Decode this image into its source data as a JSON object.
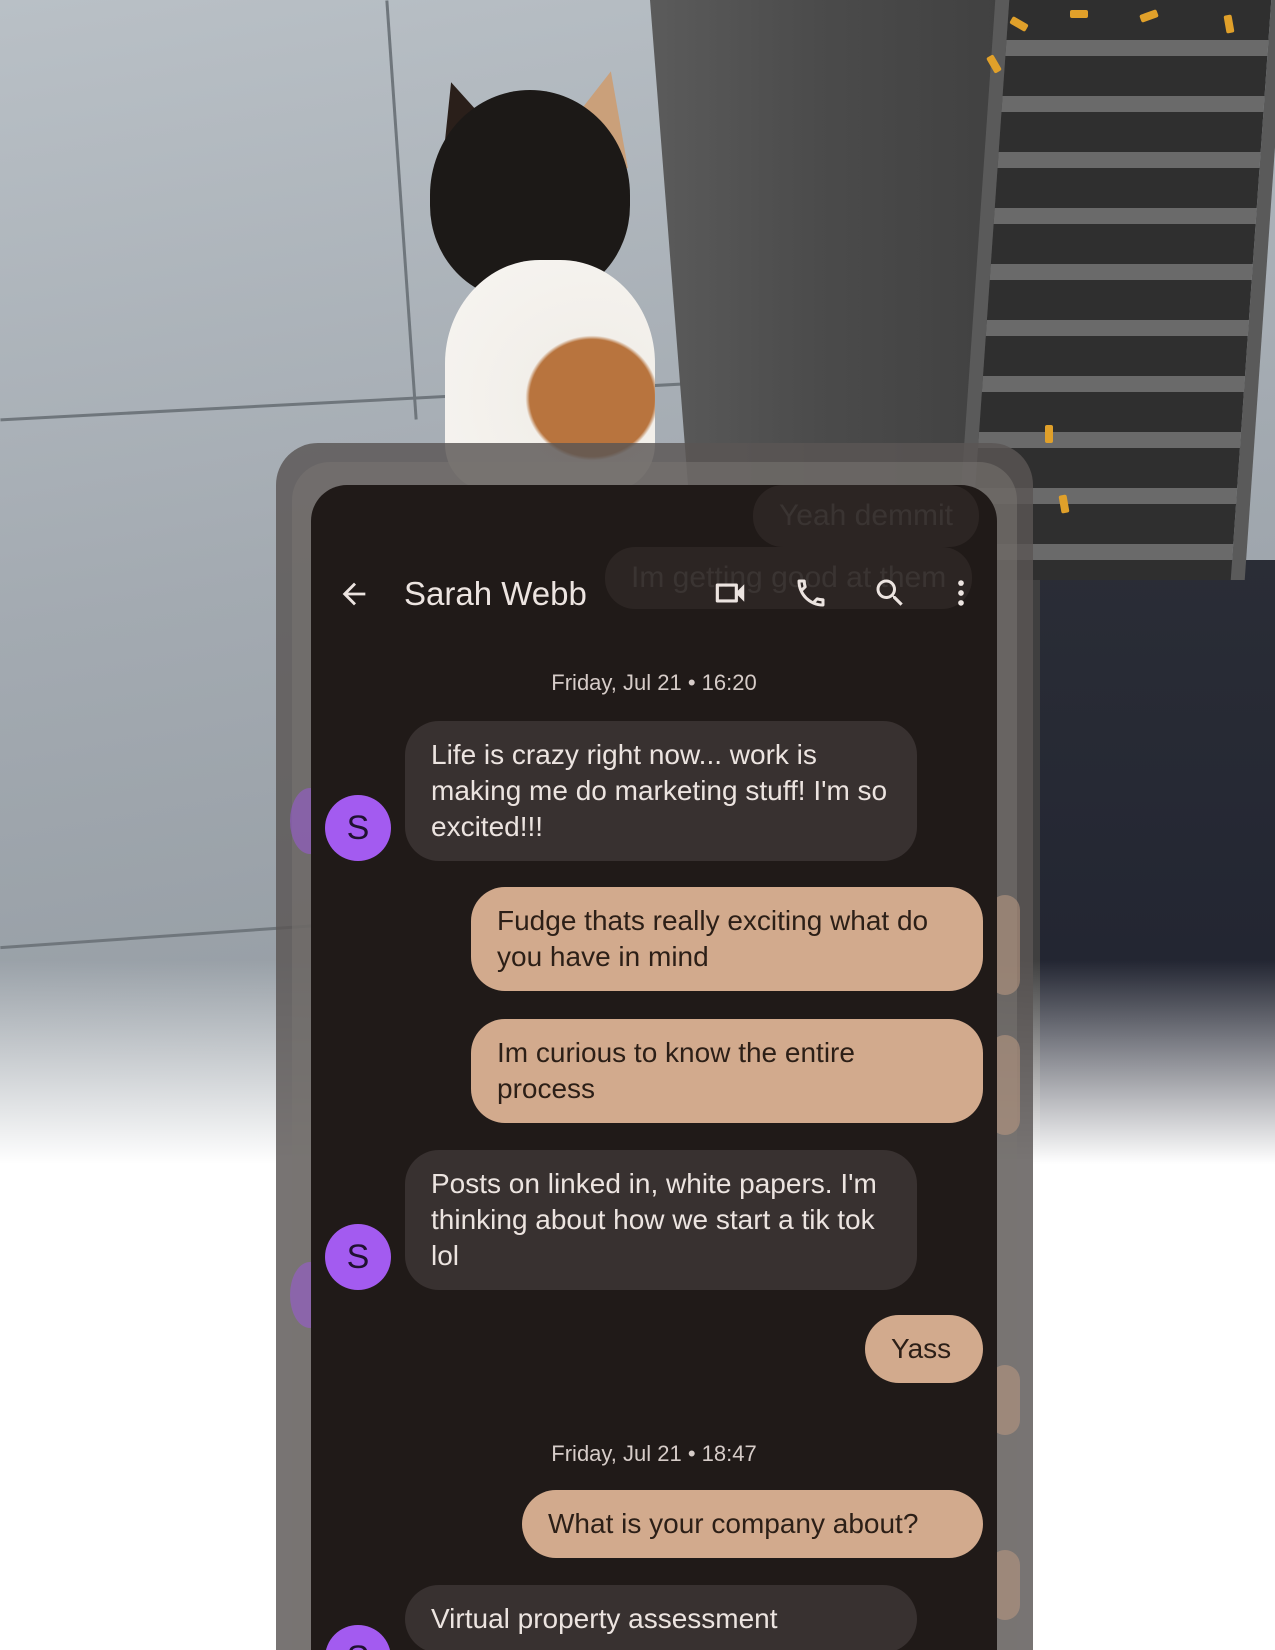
{
  "background": {
    "ghost_messages": [
      "Yeah demmit",
      "Im getting good at them"
    ]
  },
  "header": {
    "contact_name": "Sarah Webb",
    "icons": [
      "arrow-back-icon",
      "video-call-icon",
      "phone-icon",
      "search-icon",
      "more-vert-icon"
    ]
  },
  "conversation": {
    "date_1": "Friday, Jul 21 • 16:20",
    "date_2": "Friday, Jul 21 • 18:47",
    "messages": [
      {
        "from": "them",
        "text": "Life is crazy right now... work is making me do marketing stuff! I'm so excited!!!"
      },
      {
        "from": "me",
        "text": "Fudge thats really exciting what do you have in mind"
      },
      {
        "from": "me",
        "text": "Im curious to know the entire process"
      },
      {
        "from": "them",
        "text": "Posts on linked in, white papers. I'm thinking about how we start a tik tok lol"
      },
      {
        "from": "me",
        "text": "Yass"
      },
      {
        "from": "me",
        "text": "What is your company about?"
      },
      {
        "from": "them",
        "text": "Virtual property assessment"
      }
    ],
    "avatar_initial": "S"
  },
  "colors": {
    "screen_bg": "#201a18",
    "incoming_bubble": "#383130",
    "outgoing_bubble": "#d2aa8d",
    "avatar": "#a35bf0"
  }
}
